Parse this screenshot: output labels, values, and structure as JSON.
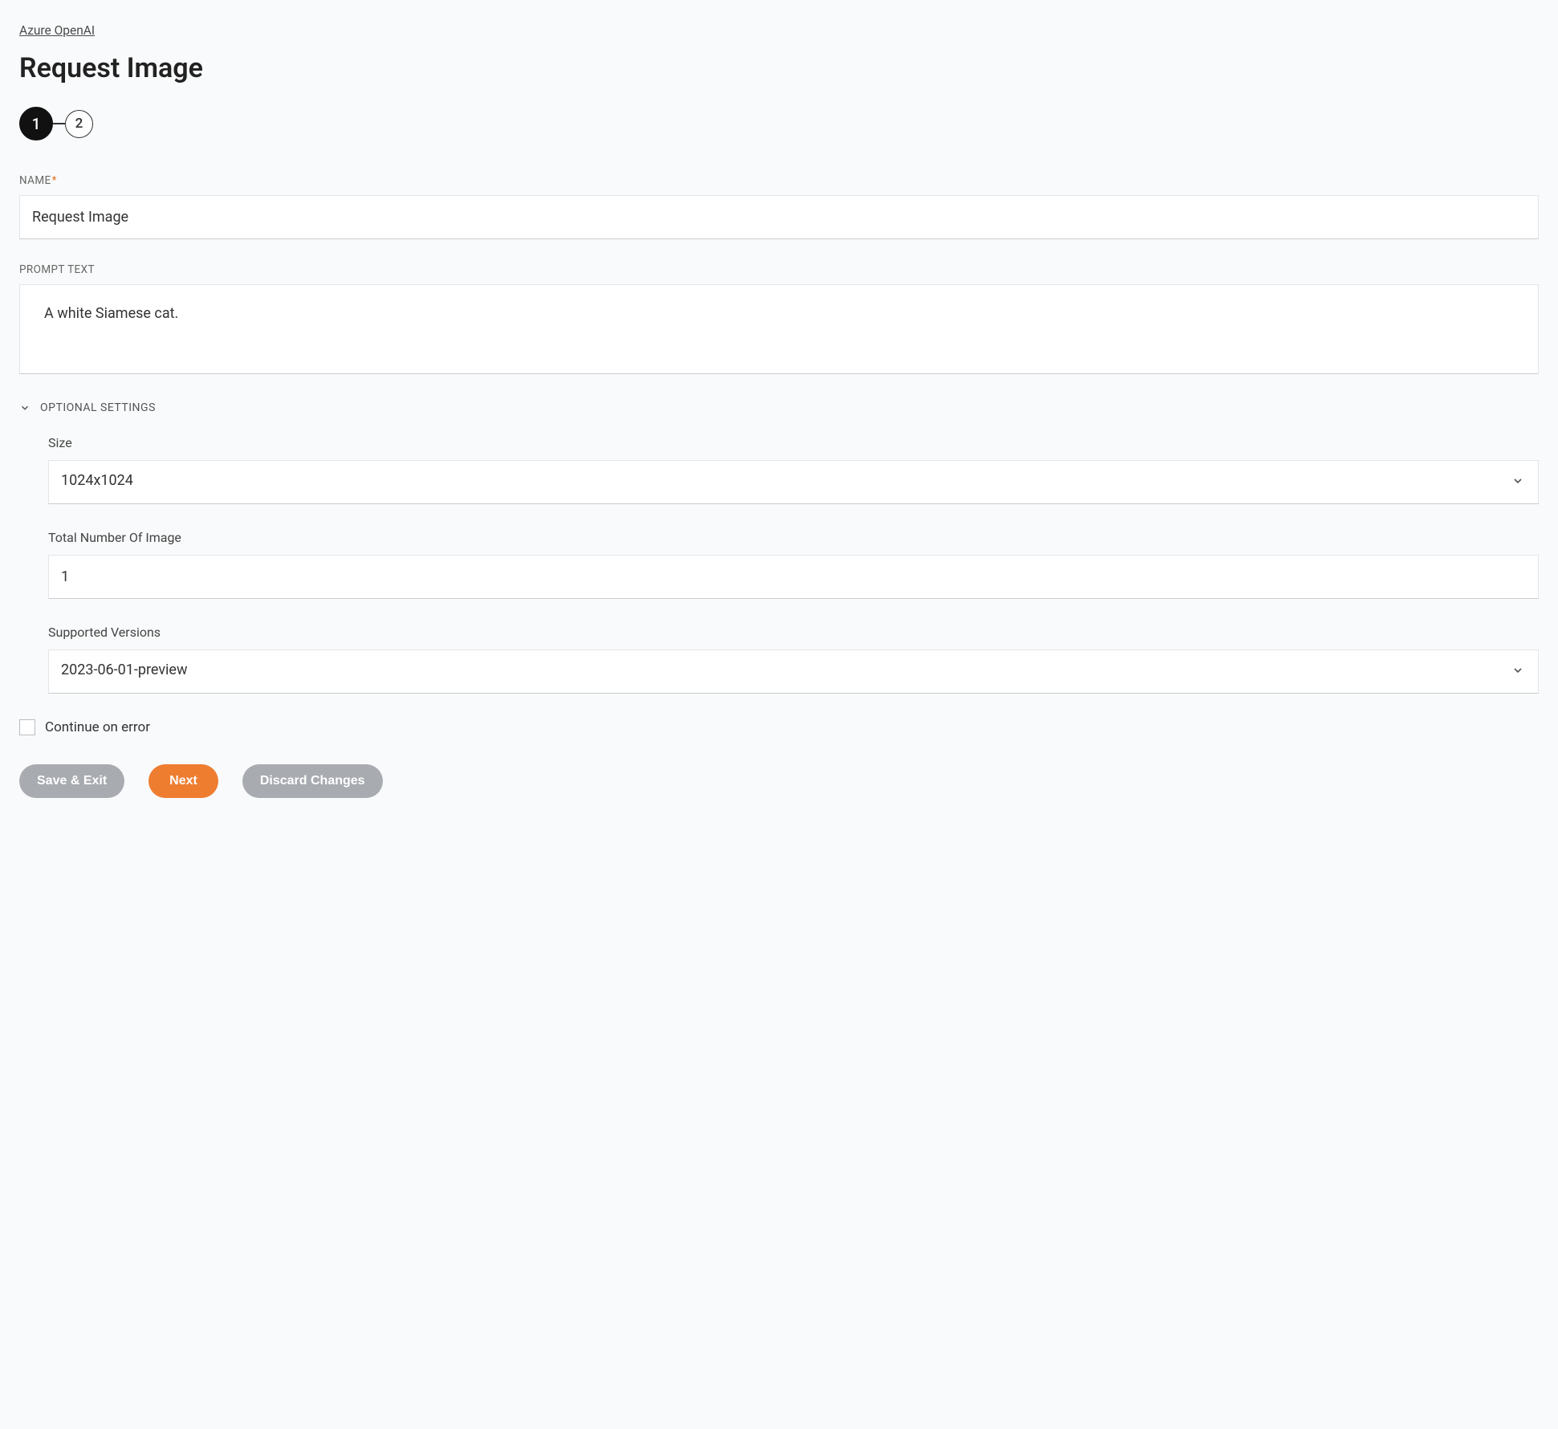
{
  "breadcrumb": "Azure OpenAI",
  "page_title": "Request Image",
  "stepper": {
    "step1": "1",
    "step2": "2"
  },
  "fields": {
    "name": {
      "label": "NAME",
      "value": "Request Image"
    },
    "prompt": {
      "label": "PROMPT TEXT",
      "value": "A white Siamese cat."
    }
  },
  "optional": {
    "header": "OPTIONAL SETTINGS",
    "size": {
      "label": "Size",
      "value": "1024x1024"
    },
    "total": {
      "label": "Total Number Of Image",
      "value": "1"
    },
    "versions": {
      "label": "Supported Versions",
      "value": "2023-06-01-preview"
    }
  },
  "continue_on_error": {
    "label": "Continue on error",
    "checked": false
  },
  "buttons": {
    "save_exit": "Save & Exit",
    "next": "Next",
    "discard": "Discard Changes"
  }
}
